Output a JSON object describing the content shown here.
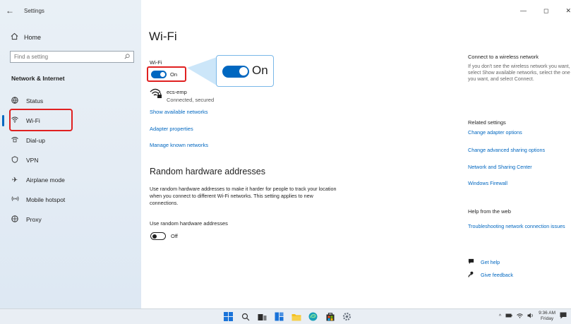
{
  "window": {
    "app_title": "Settings",
    "controls": [
      "—",
      "◻",
      "✕"
    ]
  },
  "sidebar": {
    "home_label": "Home",
    "search_placeholder": "Find a setting",
    "section_title": "Network & Internet",
    "items": [
      {
        "label": "Status",
        "icon": "globe-icon"
      },
      {
        "label": "Wi-Fi",
        "icon": "wifi-icon"
      },
      {
        "label": "Dial-up",
        "icon": "dialup-icon"
      },
      {
        "label": "VPN",
        "icon": "vpn-icon"
      },
      {
        "label": "Airplane mode",
        "icon": "airplane-icon"
      },
      {
        "label": "Mobile hotspot",
        "icon": "hotspot-icon"
      },
      {
        "label": "Proxy",
        "icon": "proxy-icon"
      }
    ],
    "active_item": "Wi-Fi"
  },
  "main": {
    "title": "Wi-Fi",
    "wifi_label": "Wi-Fi",
    "wifi_toggle_state": "On",
    "callout_label": "On",
    "network": {
      "name": "ecs-emp",
      "status": "Connected, secured"
    },
    "links": {
      "show_networks": "Show available networks",
      "adapter_properties": "Adapter properties",
      "manage_networks": "Manage known networks"
    },
    "random_hw": {
      "title": "Random hardware addresses",
      "description": "Use random hardware addresses to make it harder for people to track your location when you connect to different Wi-Fi networks. This setting applies to new connections.",
      "toggle_label": "Use random hardware addresses",
      "toggle_state": "Off"
    }
  },
  "right": {
    "connect_heading": "Connect to a wireless network",
    "connect_text": "If you don't see the wireless network you want, select Show available networks, select the one you want, and select Connect.",
    "related_heading": "Related settings",
    "related_links": [
      "Change adapter options",
      "Change advanced sharing options",
      "Network and Sharing Center",
      "Windows Firewall"
    ],
    "help_heading": "Help from the web",
    "help_link": "Troubleshooting network connection issues",
    "get_help": "Get help",
    "give_feedback": "Give feedback"
  },
  "taskbar": {
    "time": "9:36 AM",
    "day": "Friday"
  },
  "colors": {
    "accent": "#0067c0",
    "highlight_red": "#e02020",
    "callout_border": "#7ab8e8"
  }
}
